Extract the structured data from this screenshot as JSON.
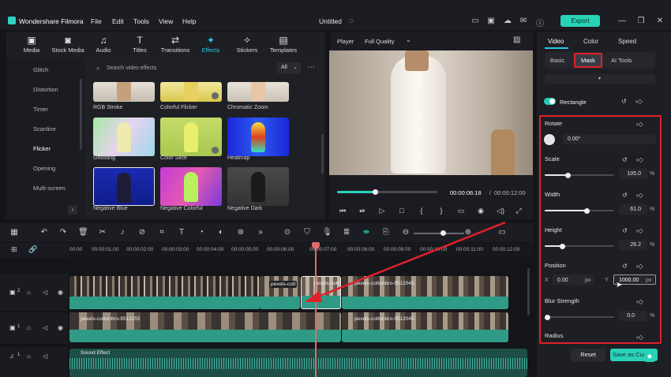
{
  "app": {
    "title": "Wondershare Filmora",
    "file_name": "Untitled",
    "export_label": "Export"
  },
  "menu": [
    "File",
    "Edit",
    "Tools",
    "View",
    "Help"
  ],
  "media_tabs": [
    {
      "label": "Media",
      "icon": "media-icon"
    },
    {
      "label": "Stock Media",
      "icon": "stock-media-icon"
    },
    {
      "label": "Audio",
      "icon": "audio-icon"
    },
    {
      "label": "Titles",
      "icon": "titles-icon"
    },
    {
      "label": "Transitions",
      "icon": "transitions-icon"
    },
    {
      "label": "Effects",
      "icon": "effects-icon",
      "active": true
    },
    {
      "label": "Stickers",
      "icon": "stickers-icon"
    },
    {
      "label": "Templates",
      "icon": "templates-icon"
    }
  ],
  "categories": [
    "Glitch",
    "Distortion",
    "Timer",
    "Scanline",
    "Flicker",
    "Opening",
    "Multi-screen"
  ],
  "active_category": "Flicker",
  "search": {
    "placeholder": "Search video effects",
    "filter": "All"
  },
  "effects": [
    {
      "label": "RGB Stroke"
    },
    {
      "label": "Colorful Flicker"
    },
    {
      "label": "Chromatic Zoom"
    },
    {
      "label": "Ghosting"
    },
    {
      "label": "Color Slice"
    },
    {
      "label": "Heatmap"
    },
    {
      "label": "Negative Blue"
    },
    {
      "label": "Negative Colorful"
    },
    {
      "label": "Negative Dark"
    }
  ],
  "player": {
    "label": "Player",
    "quality": "Full Quality",
    "current_time": "00:00:06:18",
    "total_time": "00:00:12:00",
    "progress": 0.38
  },
  "right_panel": {
    "tabs": [
      "Video",
      "Color",
      "Speed"
    ],
    "subtabs": [
      "Basic",
      "Mask",
      "AI Tools"
    ],
    "active_subtab": "Mask",
    "mask_shape": "Rectangle",
    "rotate": {
      "label": "Rotate",
      "value": "0.00°"
    },
    "scale": {
      "label": "Scale",
      "value": "105.0",
      "unit": "%",
      "level": 0.33
    },
    "width": {
      "label": "Width",
      "value": "61.0",
      "unit": "%",
      "level": 0.61
    },
    "height": {
      "label": "Height",
      "value": "26.2",
      "unit": "%",
      "level": 0.26
    },
    "position": {
      "label": "Position",
      "x_label": "X",
      "x_value": "0.00",
      "y_label": "Y",
      "y_value": "1000.00",
      "unit": "px"
    },
    "blur": {
      "label": "Blur Strength",
      "value": "0.0",
      "unit": "%",
      "level": 0.0
    },
    "radius": {
      "label": "Radius"
    },
    "reset_label": "Reset",
    "save_label": "Save as Cus"
  },
  "timeline": {
    "ruler": [
      "00:00",
      "00:00:01:00",
      "00:00:02:00",
      "00:00:03:00",
      "00:00:04:00",
      "00:00:05:00",
      "00:00:06:00",
      "00:00:07:00",
      "00:00:08:00",
      "00:00:09:00",
      "00:00:10:00",
      "00:00:11:00",
      "00:00:12:00"
    ],
    "tracks": [
      {
        "number": "2",
        "clips": [
          "pexels-cott",
          "pexels-cottonbro-9512045",
          "pexels-cottonbro-9512045"
        ]
      },
      {
        "number": "1",
        "clips": [
          "pexels-cottonbro-9512255",
          "pexels-cottonbro-9512045"
        ]
      },
      {
        "number": "1",
        "clips": [
          "Sound Effect"
        ]
      }
    ]
  },
  "colors": {
    "accent": "#27c9e8",
    "export": "#28d3b5",
    "highlight": "#e0202a",
    "clip": "#2f9a86"
  }
}
